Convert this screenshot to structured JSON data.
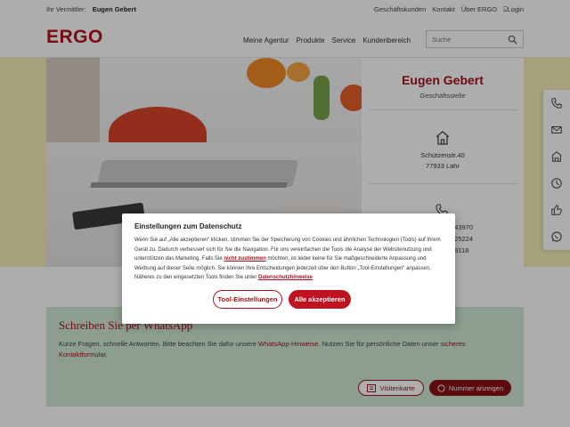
{
  "topbar": {
    "vermittler_label": "Ihr Vermittler:",
    "vermittler_name": "Eugen Gebert",
    "links": [
      "Geschäftskunden",
      "Kontakt",
      "Über ERGO",
      "Login"
    ]
  },
  "header": {
    "logo": "ERGO",
    "nav": [
      "Meine Agentur",
      "Produkte",
      "Service",
      "Kundenbereich"
    ],
    "search_placeholder": "Suche"
  },
  "agent": {
    "name": "Eugen Gebert",
    "role": "Geschäftsstelle",
    "street": "Schützenstr.40",
    "city": "77933 Lahr",
    "phone_fragments": [
      "543970",
      "225224",
      "08118"
    ]
  },
  "whatsapp": {
    "title": "Schreiben Sie per WhatsApp",
    "text_before_link1": "Kurze Fragen, schnelle Antworten. Bitte beachten Sie dafür unsere ",
    "link1": "WhatsApp-Hinweise",
    "text_between": ". Nutzen Sie für persönliche Daten unser ",
    "link2": "sicheres Kontaktformular",
    "text_after": ".",
    "btn_card": "Visitenkarte",
    "btn_number": "Nummer anzeigen"
  },
  "modal": {
    "title": "Einstellungen zum Datenschutz",
    "text_part1": "Wenn Sie auf „Alle akzeptieren“ klicken, stimmen Sie der Speicherung von Cookies und ähnlichen Technologien (Tools) auf Ihrem Gerät zu. Dadurch verbessert sich für Sie die Navigation. Für uns vereinfachen die Tools die Analyse der Websitenutzung und unterstützen das Marketing. Falls Sie ",
    "link_reject": "nicht zustimmen",
    "text_part2": " möchten, ist leider keine für Sie maßgeschneiderte Anpassung und Werbung auf dieser Seite möglich. Sie können Ihre Entscheidungen jederzeit über den Button „Tool-Einstellungen“ anpassen. Näheres zu den eingesetzten Tools finden Sie unter ",
    "link_privacy": "Datenschutzhinweise",
    "btn_tools": "Tool-Einstellungen",
    "btn_accept": "Alle akzeptieren"
  },
  "sidetools": {
    "icons": [
      "phone-icon",
      "mail-icon",
      "building-icon",
      "clock-icon",
      "thumbs-up-icon",
      "whatsapp-icon"
    ]
  },
  "colors": {
    "brand": "#a2121c",
    "accept": "#bf1322",
    "hero_band": "#f7ecb7",
    "whatsapp_box": "#cde9d5"
  }
}
